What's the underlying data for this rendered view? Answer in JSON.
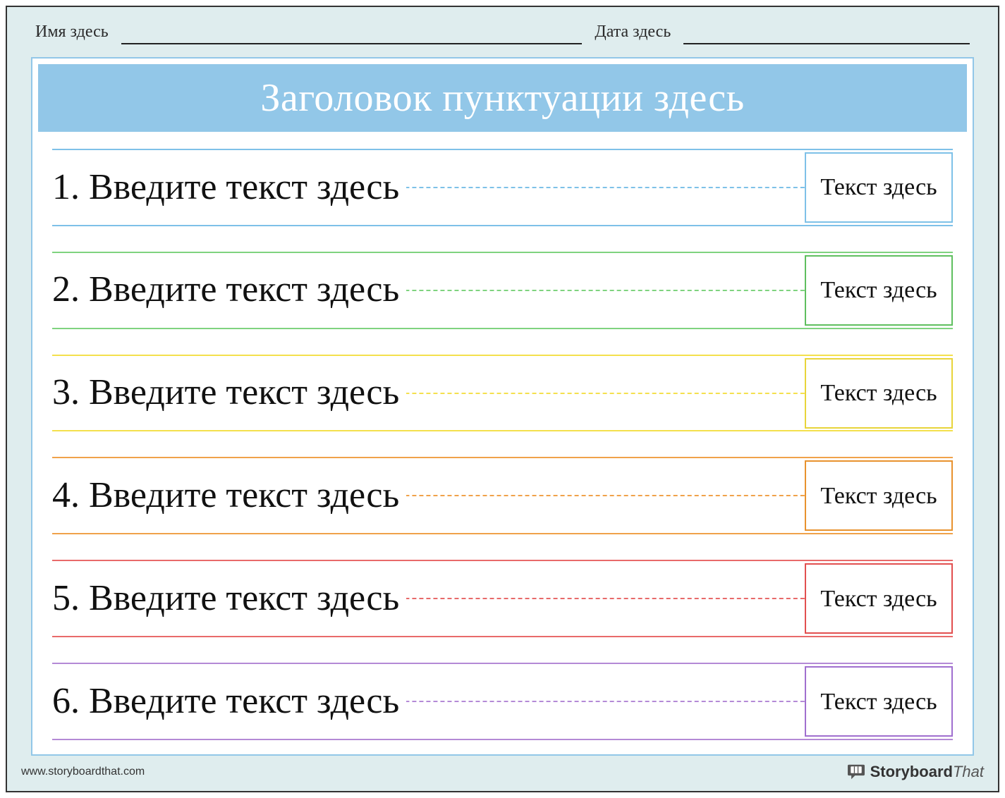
{
  "header": {
    "name_label": "Имя здесь",
    "date_label": "Дата здесь"
  },
  "title": "Заголовок пунктуации здесь",
  "rows": [
    {
      "text": "1. Введите текст здесь",
      "box": "Текст здесь",
      "color": "c-blue"
    },
    {
      "text": "2. Введите текст здесь",
      "box": "Текст здесь",
      "color": "c-green"
    },
    {
      "text": "3. Введите текст здесь",
      "box": "Текст здесь",
      "color": "c-yellow"
    },
    {
      "text": "4. Введите текст здесь",
      "box": "Текст здесь",
      "color": "c-orange"
    },
    {
      "text": "5. Введите текст здесь",
      "box": "Текст здесь",
      "color": "c-red"
    },
    {
      "text": "6. Введите текст здесь",
      "box": "Текст здесь",
      "color": "c-purple"
    }
  ],
  "footer": {
    "url": "www.storyboardthat.com",
    "brand1": "Storyboard",
    "brand2": "That"
  }
}
